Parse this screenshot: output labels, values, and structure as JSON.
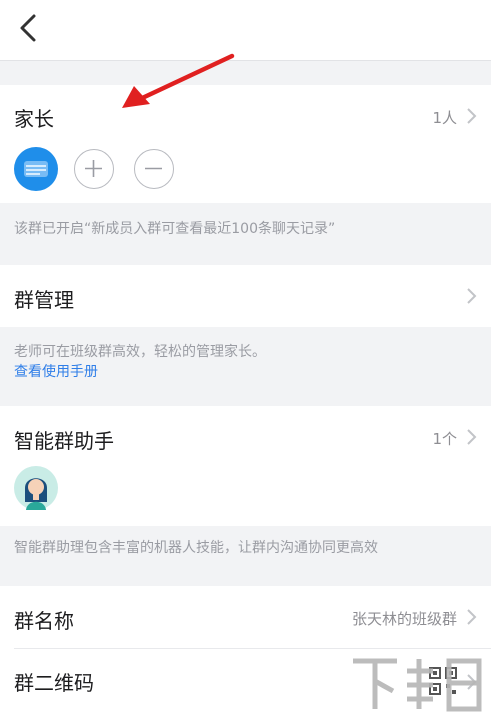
{
  "header": {
    "back_icon": "chevron-left-icon"
  },
  "parents": {
    "title": "家长",
    "count": "1人",
    "members": [
      {
        "avatar": "blurred-avatar"
      }
    ],
    "actions": {
      "add_icon": "plus-circle-icon",
      "remove_icon": "minus-circle-icon"
    },
    "note": "该群已开启“新成员入群可查看最近100条聊天记录”"
  },
  "group_management": {
    "title": "群管理",
    "note": "老师可在班级群高效，轻松的管理家长。",
    "link": "查看使用手册"
  },
  "smart_assistant": {
    "title": "智能群助手",
    "count": "1个",
    "note": "智能群助理包含丰富的机器人技能，让群内沟通协同更高效"
  },
  "group_name": {
    "title": "群名称",
    "value": "张天林的班级群"
  },
  "group_qr": {
    "title": "群二维码",
    "icon": "qr-code-icon"
  },
  "colors": {
    "accent": "#2f7ee8",
    "avatar_blue": "#1f8eea",
    "arrow_red": "#e02020"
  }
}
